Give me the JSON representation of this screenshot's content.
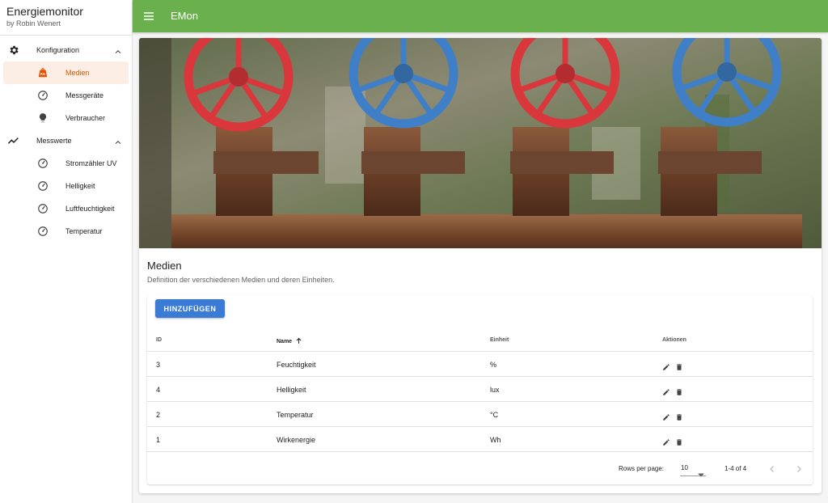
{
  "brand": {
    "title": "Energiemonitor",
    "subtitle": "by Robin Wenert"
  },
  "app": {
    "title": "EMon",
    "topbar_color": "#6ab04c",
    "accent": "#e65100",
    "button_color": "#3a7bd5"
  },
  "sidebar": {
    "groups": [
      {
        "label": "Konfiguration",
        "icon": "gear-icon",
        "expanded": true,
        "items": [
          {
            "label": "Medien",
            "icon": "weight-kg-icon",
            "active": true
          },
          {
            "label": "Messgeräte",
            "icon": "gauge-icon",
            "active": false
          },
          {
            "label": "Verbraucher",
            "icon": "lightbulb-icon",
            "active": false
          }
        ]
      },
      {
        "label": "Messwerte",
        "icon": "chart-line-icon",
        "expanded": true,
        "items": [
          {
            "label": "Stromzähler UV",
            "icon": "gauge-icon",
            "active": false
          },
          {
            "label": "Helligkeit",
            "icon": "gauge-icon",
            "active": false
          },
          {
            "label": "Luftfeuchtigkeit",
            "icon": "gauge-icon",
            "active": false
          },
          {
            "label": "Temperatur",
            "icon": "gauge-icon",
            "active": false
          }
        ]
      }
    ]
  },
  "page": {
    "title": "Medien",
    "subtitle": "Definition der verschiedenen Medien und deren Einheiten.",
    "add_button": "HINZUFÜGEN"
  },
  "table": {
    "columns": [
      "ID",
      "Name",
      "Einheit",
      "Aktionen"
    ],
    "sorted_column": "Name",
    "sort_direction": "ascending",
    "rows": [
      {
        "id": "3",
        "name": "Feuchtigkeit",
        "unit": "%"
      },
      {
        "id": "4",
        "name": "Helligkeit",
        "unit": "lux"
      },
      {
        "id": "2",
        "name": "Temperatur",
        "unit": "°C"
      },
      {
        "id": "1",
        "name": "Wirkenergie",
        "unit": "Wh"
      }
    ],
    "row_actions": [
      "pencil-icon",
      "trash-icon"
    ]
  },
  "pagination": {
    "rows_per_page_label": "Rows per page:",
    "rows_per_page": "10",
    "range": "1-4 of 4"
  }
}
